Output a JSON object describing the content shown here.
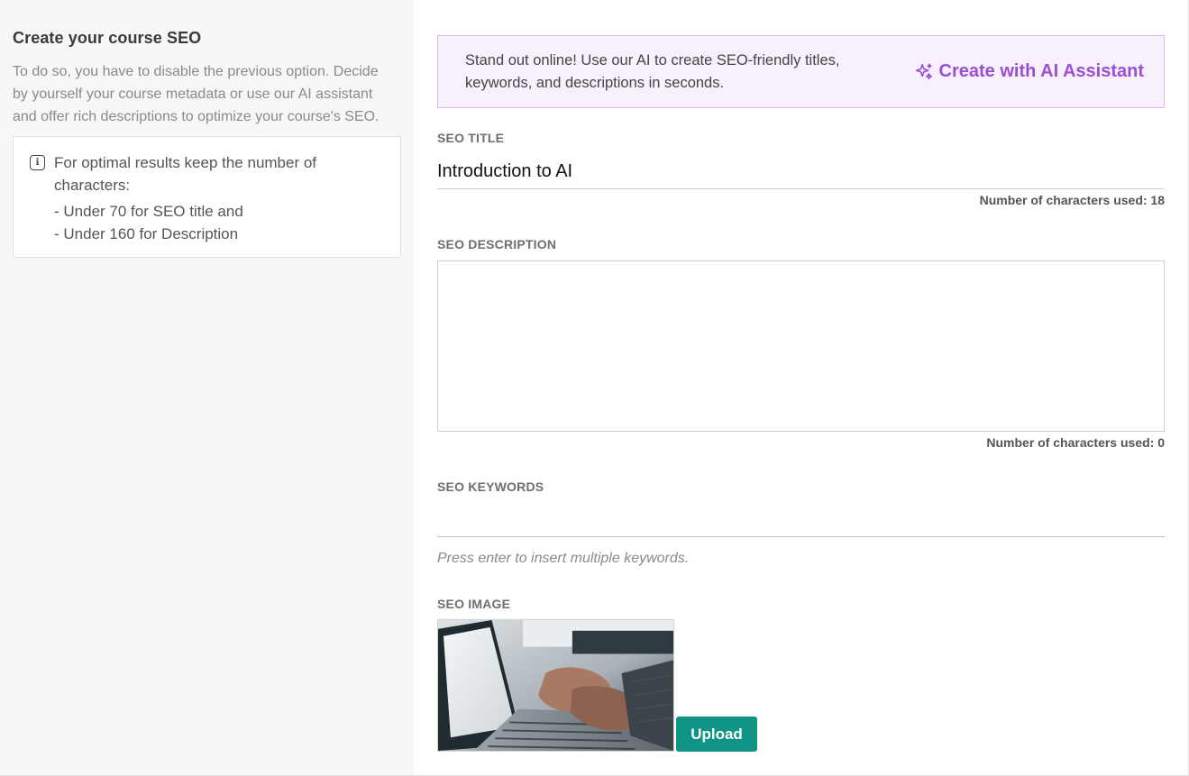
{
  "left": {
    "title": "Create your course SEO",
    "description": "To do so, you have to disable the previous option. Decide by yourself your course metadata or use our AI assistant and offer rich descriptions to optimize your course's SEO.",
    "info": {
      "line1": "For optimal results keep the number of",
      "line2": "characters:",
      "line3": "- Under 70 for SEO title and",
      "line4": "- Under 160 for Description"
    }
  },
  "ai_banner": {
    "message": "Stand out online! Use our AI to create SEO-friendly titles, keywords, and descriptions in seconds.",
    "button_label": "Create with AI Assistant"
  },
  "seo_title": {
    "label": "SEO TITLE",
    "value": "Introduction to AI",
    "counter": "Number of characters used: 18"
  },
  "seo_description": {
    "label": "SEO DESCRIPTION",
    "value": "",
    "counter": "Number of characters used: 0"
  },
  "seo_keywords": {
    "label": "SEO KEYWORDS",
    "value": "",
    "hint": "Press enter to insert multiple keywords."
  },
  "seo_image": {
    "label": "SEO IMAGE",
    "upload_label": "Upload"
  },
  "colors": {
    "ai_accent": "#9a4fd3",
    "ai_banner_bg": "#f8f1fd",
    "upload_button": "#0f9486",
    "left_panel_bg": "#f7f7f7"
  },
  "icons": {
    "info": "info-icon",
    "sparkle": "sparkle-icon"
  }
}
